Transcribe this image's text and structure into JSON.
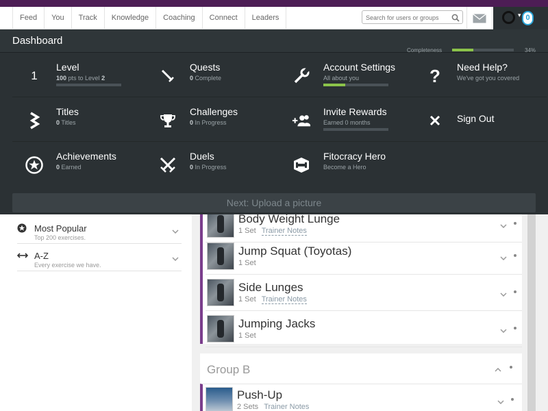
{
  "nav": {
    "items": [
      "Feed",
      "You",
      "Track",
      "Knowledge",
      "Coaching",
      "Connect",
      "Leaders"
    ],
    "search_placeholder": "Search for users or groups",
    "notification_count": "0"
  },
  "dashboard": {
    "title": "Dashboard",
    "completeness_label": "Completeness",
    "completeness_pct": "34%",
    "completeness_value": 0.34,
    "cells": {
      "level": {
        "number": "1",
        "title": "Level",
        "sub_prefix": "100",
        "sub_mid": " pts to Level ",
        "sub_suffix": "2",
        "progress": 0.0
      },
      "quests": {
        "title": "Quests",
        "sub_num": "0",
        "sub_text": " Complete"
      },
      "account": {
        "title": "Account Settings",
        "sub": "All about you",
        "progress": 0.34
      },
      "help": {
        "title": "Need Help?",
        "sub": "We've got you covered"
      },
      "titles": {
        "title": "Titles",
        "sub_num": "0",
        "sub_text": " Titles"
      },
      "challenges": {
        "title": "Challenges",
        "sub_num": "0",
        "sub_text": " In Progress"
      },
      "invite": {
        "title": "Invite Rewards",
        "sub": "Earned 0 months",
        "progress": 0.0
      },
      "signout": {
        "title": "Sign Out"
      },
      "achievements": {
        "title": "Achievements",
        "sub_num": "0",
        "sub_text": " Earned"
      },
      "duels": {
        "title": "Duels",
        "sub_num": "0",
        "sub_text": " In Progress"
      },
      "hero": {
        "title": "Fitocracy Hero",
        "sub": "Become a Hero"
      }
    },
    "next_label": "Next: Upload a picture"
  },
  "categories": [
    {
      "title": "Most Popular",
      "sub": "Top 200 exercises."
    },
    {
      "title": "A-Z",
      "sub": "Every exercise we have."
    }
  ],
  "group_a": {
    "exercises": [
      {
        "name": "Body Weight Lunge",
        "sets": "1 Set",
        "notes": "Trainer Notes"
      },
      {
        "name": "Jump Squat (Toyotas)",
        "sets": "1 Set",
        "notes": ""
      },
      {
        "name": "Side Lunges",
        "sets": "1 Set",
        "notes": "Trainer Notes"
      },
      {
        "name": "Jumping Jacks",
        "sets": "1 Set",
        "notes": ""
      }
    ]
  },
  "group_b": {
    "title": "Group B",
    "exercises": [
      {
        "name": "Push-Up",
        "sets": "2 Sets",
        "notes": "Trainer Notes"
      }
    ]
  },
  "colors": {
    "header_purple": "#4d1d55",
    "dashboard_bg": "#2b3134",
    "progress_green": "#8bc34a",
    "group_accent": "#7a3d8c",
    "badge_blue": "#29a3d6"
  }
}
